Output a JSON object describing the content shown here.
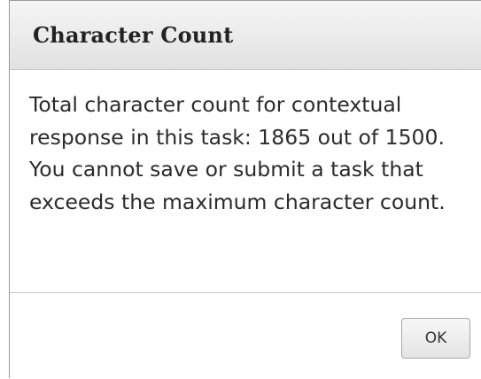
{
  "dialog": {
    "title": "Character Count",
    "message": "Total character count for contextual response in this task: 1865 out of 1500. You cannot save or submit a task that exceeds the maximum character count.",
    "ok_label": "OK"
  }
}
